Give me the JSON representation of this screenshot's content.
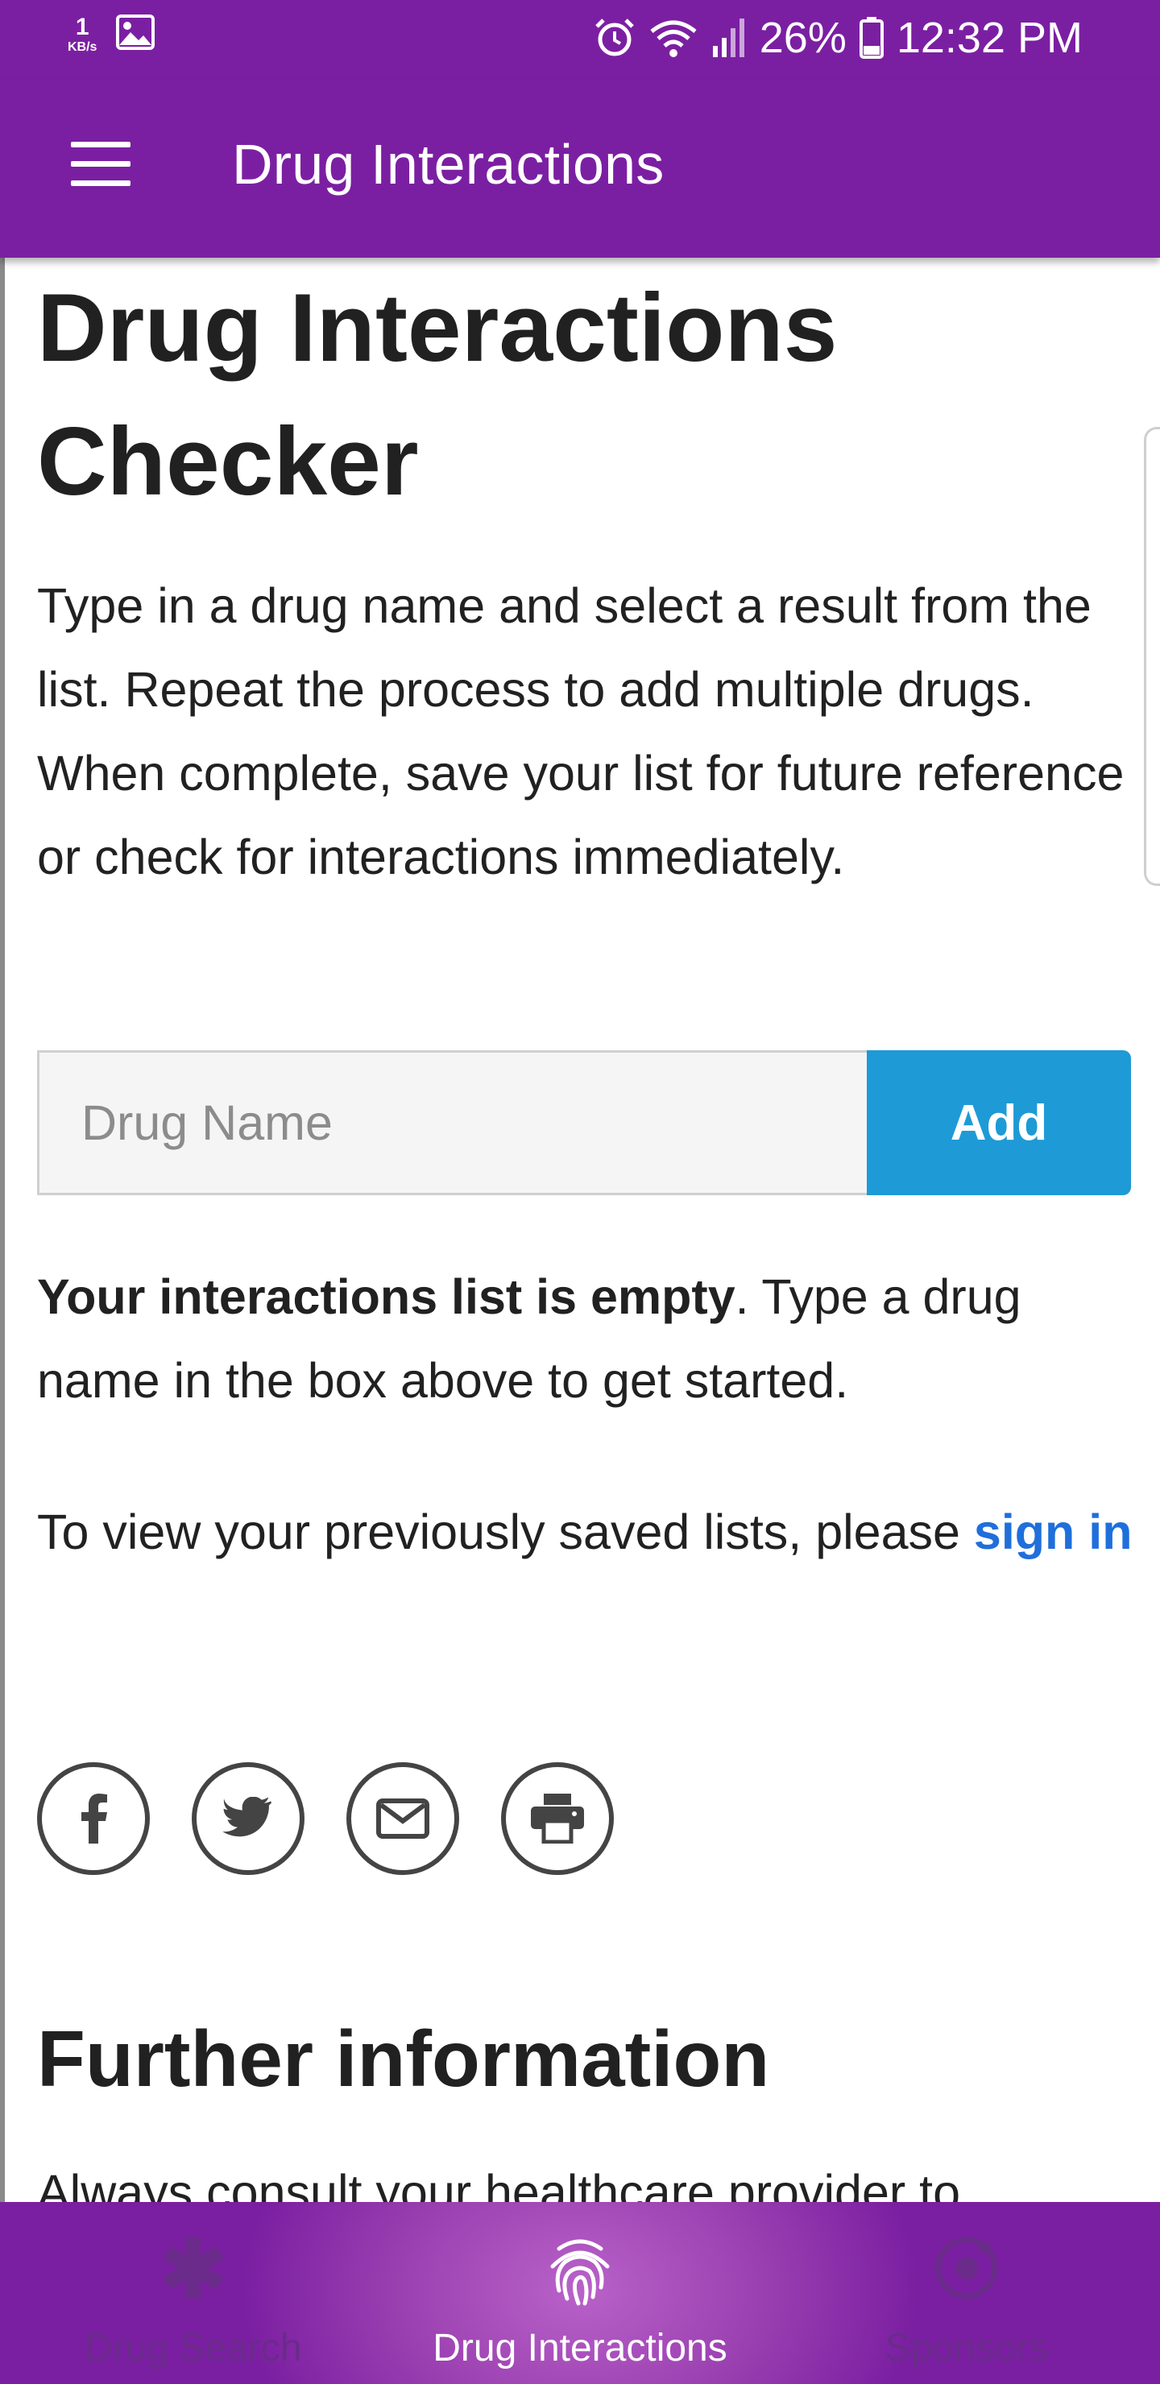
{
  "status_bar": {
    "speed_value": "1",
    "speed_unit": "KB/s",
    "battery": "26%",
    "time": "12:32 PM",
    "icons": [
      "image-icon",
      "alarm-icon",
      "wifi-icon",
      "signal-icon",
      "battery-icon"
    ]
  },
  "app_bar": {
    "title": "Drug Interactions",
    "menu_icon": "hamburger-menu-icon"
  },
  "main": {
    "heading": "Drug Interactions Checker",
    "intro": "Type in a drug name and select a result from the list. Repeat the process to add multiple drugs. When complete, save your list for future reference or check for interactions immediately.",
    "search": {
      "placeholder": "Drug Name",
      "value": "",
      "add_label": "Add"
    },
    "empty_bold": "Your interactions list is empty",
    "empty_rest": ". Type a drug name in the box above to get started.",
    "saved_prefix": "To view your previously saved lists, please ",
    "signin_label": "sign in",
    "share_icons": [
      "facebook-icon",
      "twitter-icon",
      "email-icon",
      "print-icon"
    ],
    "further_heading": "Further information",
    "further_text": "Always consult your healthcare provider to"
  },
  "bottom_nav": {
    "items": [
      {
        "label": "Drug Search",
        "icon": "asterisk-icon",
        "active": false
      },
      {
        "label": "Drug Interactions",
        "icon": "fingerprint-icon",
        "active": true
      },
      {
        "label": "Sponsors",
        "icon": "target-icon",
        "active": false
      }
    ]
  },
  "colors": {
    "primary": "#7b1fa2",
    "accent_button": "#1e9ad6",
    "link": "#1f6fdb"
  }
}
